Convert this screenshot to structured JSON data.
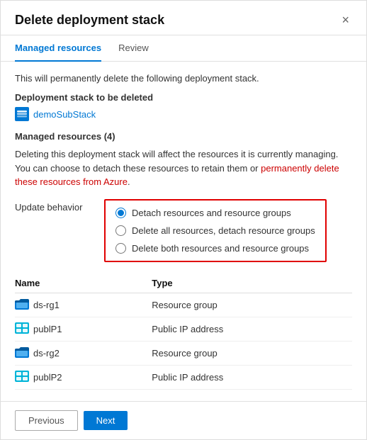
{
  "dialog": {
    "title": "Delete deployment stack",
    "close_label": "×"
  },
  "tabs": [
    {
      "id": "managed-resources",
      "label": "Managed resources",
      "active": true
    },
    {
      "id": "review",
      "label": "Review",
      "active": false
    }
  ],
  "body": {
    "info_text": "This will permanently delete the following deployment stack.",
    "deployment_stack_label": "Deployment stack to be deleted",
    "deployment_stack_name": "demoSubStack",
    "managed_resources_label": "Managed resources (4)",
    "warning_text_part1": "Deleting this deployment stack will affect the resources it is currently managing. You can choose to detach these resources to retain them or ",
    "warning_text_red": "permanently delete these resources from Azure",
    "warning_text_part2": ".",
    "update_behavior_label": "Update behavior",
    "radio_options": [
      {
        "id": "detach",
        "label": "Detach resources and resource groups",
        "checked": true
      },
      {
        "id": "delete-all",
        "label": "Delete all resources, detach resource groups",
        "checked": false
      },
      {
        "id": "delete-both",
        "label": "Delete both resources and resource groups",
        "checked": false
      }
    ],
    "table": {
      "columns": [
        "Name",
        "Type"
      ],
      "rows": [
        {
          "name": "ds-rg1",
          "type": "Resource group",
          "icon": "rg"
        },
        {
          "name": "publP1",
          "type": "Public IP address",
          "icon": "pip"
        },
        {
          "name": "ds-rg2",
          "type": "Resource group",
          "icon": "rg"
        },
        {
          "name": "publP2",
          "type": "Public IP address",
          "icon": "pip"
        }
      ]
    }
  },
  "footer": {
    "previous_label": "Previous",
    "next_label": "Next"
  }
}
